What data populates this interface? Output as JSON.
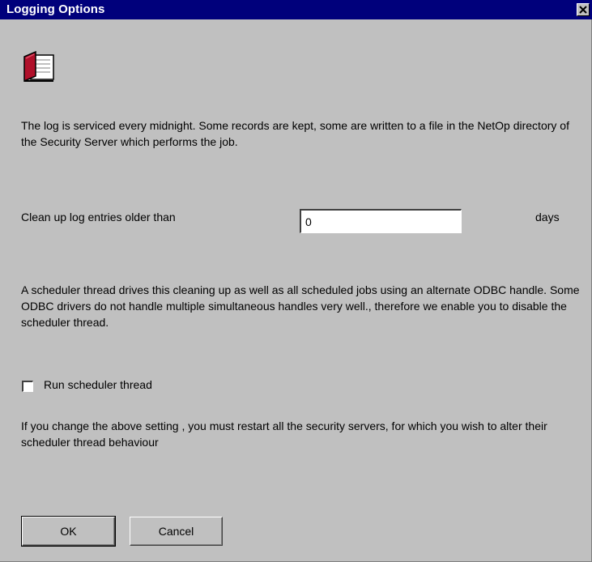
{
  "window": {
    "title": "Logging Options"
  },
  "icons": {
    "title_close": "close-icon",
    "header": "book-icon"
  },
  "intro_text": "The log is serviced every midnight. Some records are kept, some are written to a file in the NetOp directory of the Security Server which performs the job.",
  "cleanup": {
    "label": "Clean up log entries older than",
    "value": "0",
    "unit_label": "days"
  },
  "scheduler_info": "A scheduler thread drives this cleaning up as well as all scheduled jobs using an alternate ODBC handle. Some ODBC drivers do not handle multiple simultaneous handles very well., therefore we enable you to disable the scheduler thread.",
  "scheduler_checkbox": {
    "label": "Run scheduler thread",
    "checked": false
  },
  "restart_note": "If you change the above setting , you must restart all the security servers, for which you wish  to alter their scheduler thread behaviour",
  "buttons": {
    "ok": "OK",
    "cancel": "Cancel"
  },
  "colors": {
    "titlebar": "#00007b",
    "face": "#c0c0c0",
    "book_red": "#b0102a"
  }
}
